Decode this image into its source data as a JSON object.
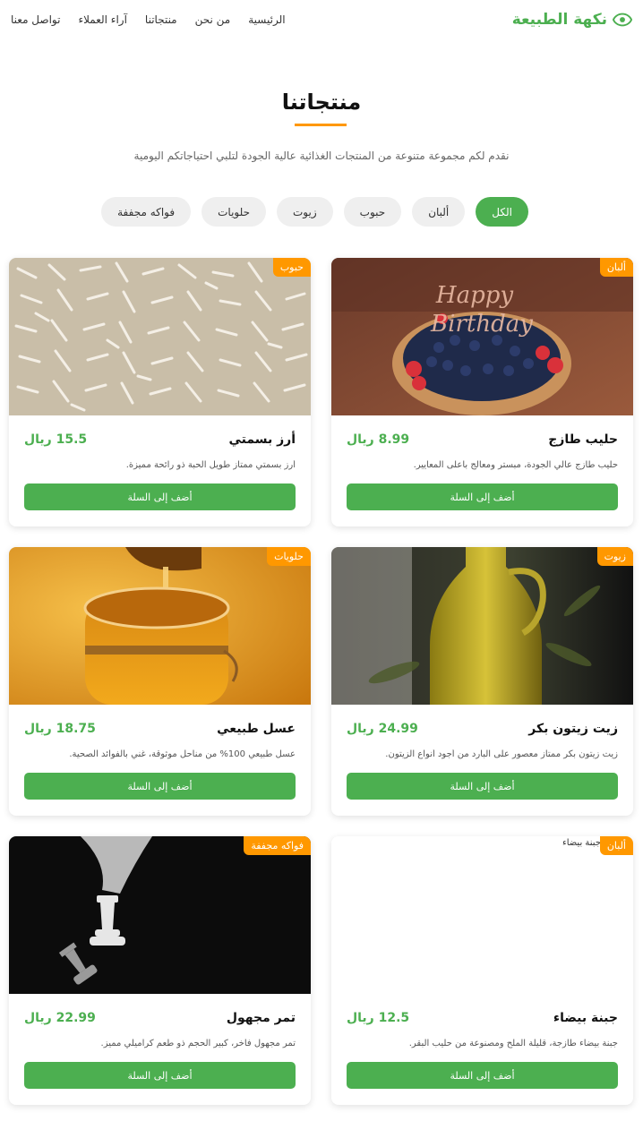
{
  "brand": {
    "name": "نكهة الطبيعة",
    "color": "#4caf50",
    "icon": "eye-icon"
  },
  "nav": [
    "الرئيسية",
    "من نحن",
    "منتجاتنا",
    "آراء العملاء",
    "تواصل معنا"
  ],
  "section": {
    "title": "منتجاتنا",
    "subtitle": "نقدم لكم مجموعة متنوعة من المنتجات الغذائية عالية الجودة لتلبي احتياجاتكم اليومية"
  },
  "filters": [
    {
      "label": "الكل",
      "active": true
    },
    {
      "label": "ألبان",
      "active": false
    },
    {
      "label": "حبوب",
      "active": false
    },
    {
      "label": "زيوت",
      "active": false
    },
    {
      "label": "حلويات",
      "active": false
    },
    {
      "label": "فواكه مجففة",
      "active": false
    }
  ],
  "accent_colors": {
    "primary": "#4caf50",
    "badge": "#ff9800"
  },
  "products": [
    {
      "name": "حليب طازج",
      "price": "8.99 ريال",
      "category": "ألبان",
      "description": "حليب طازج عالي الجودة، مبستر ومعالج بأعلى المعايير.",
      "button": "أضف إلى السلة",
      "image": "birthday-cake-photo"
    },
    {
      "name": "أرز بسمتي",
      "price": "15.5 ريال",
      "category": "حبوب",
      "description": "أرز بسمتي ممتاز طويل الحبة ذو رائحة مميزة.",
      "button": "أضف إلى السلة",
      "image": "rice-grains-photo"
    },
    {
      "name": "زيت زيتون بكر",
      "price": "24.99 ريال",
      "category": "زيوت",
      "description": "زيت زيتون بكر ممتاز معصور على البارد من أجود أنواع الزيتون.",
      "button": "أضف إلى السلة",
      "image": "olive-oil-bottle-photo"
    },
    {
      "name": "عسل طبيعي",
      "price": "18.75 ريال",
      "category": "حلويات",
      "description": "عسل طبيعي 100% من مناحل موثوقة، غني بالفوائد الصحية.",
      "button": "أضف إلى السلة",
      "image": "honey-jar-photo"
    },
    {
      "name": "جبنة بيضاء",
      "price": "12.5 ريال",
      "category": "ألبان",
      "description": "جبنة بيضاء طازجة، قليلة الملح ومصنوعة من حليب البقر.",
      "button": "أضف إلى السلة",
      "image": "broken-image",
      "image_alt": "جبنة بيضاء"
    },
    {
      "name": "تمر مجهول",
      "price": "22.99 ريال",
      "category": "فواكه مجففة",
      "description": "تمر مجهول فاخر، كبير الحجم ذو طعم كراميلي مميز.",
      "button": "أضف إلى السلة",
      "image": "chess-pieces-photo"
    }
  ]
}
